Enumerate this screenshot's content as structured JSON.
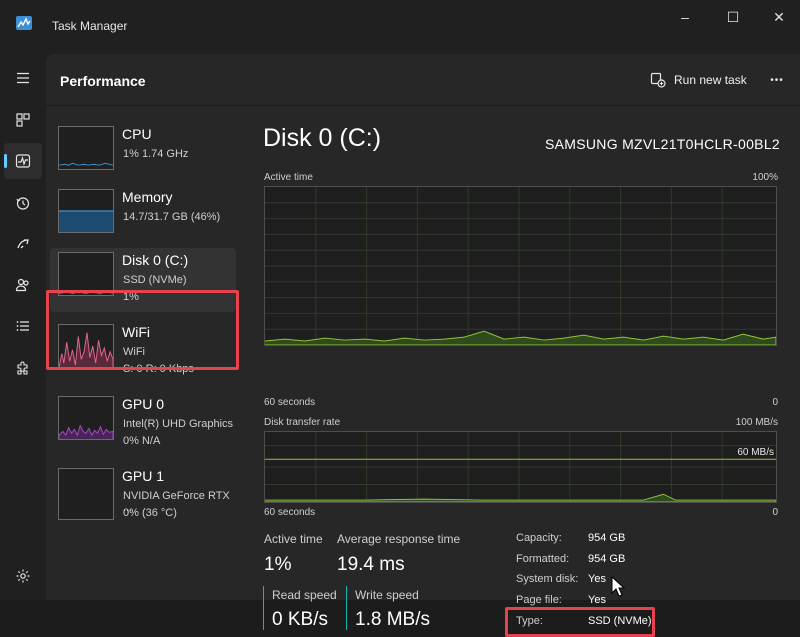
{
  "window": {
    "title": "Task Manager",
    "minimize": "–",
    "maximize": "☐",
    "close": "✕"
  },
  "page": {
    "title": "Performance",
    "run_new_task": "Run new task",
    "more": "•••"
  },
  "devices": [
    {
      "name": "CPU",
      "sub1": "1%  1.74 GHz",
      "sub2": ""
    },
    {
      "name": "Memory",
      "sub1": "14.7/31.7 GB (46%)",
      "sub2": ""
    },
    {
      "name": "Disk 0 (C:)",
      "sub1": "SSD (NVMe)",
      "sub2": "1%"
    },
    {
      "name": "WiFi",
      "sub1": "WiFi",
      "sub2": "S: 0  R: 0 Kbps"
    },
    {
      "name": "GPU 0",
      "sub1": "Intel(R) UHD Graphics",
      "sub2": "0%  N/A"
    },
    {
      "name": "GPU 1",
      "sub1": "NVIDIA GeForce RTX ...",
      "sub2": "0%  (36 °C)"
    }
  ],
  "detail": {
    "title": "Disk 0 (C:)",
    "model": "SAMSUNG MZVL21T0HCLR-00BL2",
    "active_graph": {
      "label": "Active time",
      "max": "100%",
      "time": "60 seconds",
      "min": "0"
    },
    "transfer_graph": {
      "label": "Disk transfer rate",
      "max": "100 MB/s",
      "mid": "60 MB/s",
      "time": "60 seconds",
      "min": "0"
    },
    "stats": {
      "active_time_label": "Active time",
      "active_time_value": "1%",
      "avg_response_label": "Average response time",
      "avg_response_value": "19.4 ms",
      "read_label": "Read speed",
      "read_value": "0 KB/s",
      "write_label": "Write speed",
      "write_value": "1.8 MB/s"
    },
    "info": [
      {
        "label": "Capacity:",
        "value": "954 GB"
      },
      {
        "label": "Formatted:",
        "value": "954 GB"
      },
      {
        "label": "System disk:",
        "value": "Yes"
      },
      {
        "label": "Page file:",
        "value": "Yes"
      },
      {
        "label": "Type:",
        "value": "SSD (NVMe)"
      }
    ]
  },
  "colors": {
    "accent": "#60cdff",
    "disk_green": "#8fc43c",
    "cpu_blue": "#3a94cf",
    "wifi_pink": "#e0688f",
    "gpu_purple": "#a64bc8",
    "highlight_red": "#e8424f",
    "speed_teal": "#1bb3ad"
  }
}
